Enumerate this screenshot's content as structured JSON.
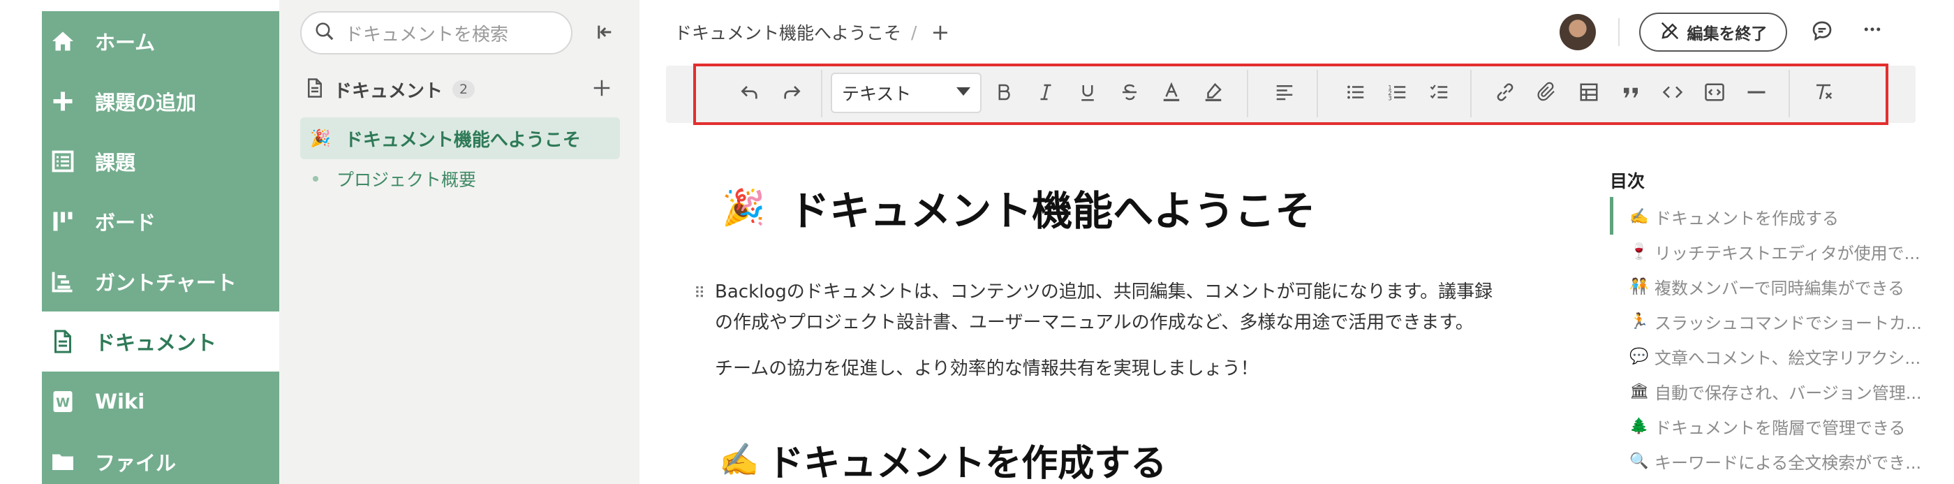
{
  "nav": {
    "items": [
      {
        "label": "ホーム",
        "icon": "home-icon",
        "active": false
      },
      {
        "label": "課題の追加",
        "icon": "plus-icon",
        "active": false
      },
      {
        "label": "課題",
        "icon": "list-icon",
        "active": false
      },
      {
        "label": "ボード",
        "icon": "board-icon",
        "active": false
      },
      {
        "label": "ガントチャート",
        "icon": "gantt-icon",
        "active": false
      },
      {
        "label": "ドキュメント",
        "icon": "document-icon",
        "active": true
      },
      {
        "label": "Wiki",
        "icon": "wiki-icon",
        "active": false
      },
      {
        "label": "ファイル",
        "icon": "folder-icon",
        "active": false
      }
    ],
    "colors": {
      "bg": "#73ad8e",
      "active_text": "#2e7a57"
    }
  },
  "tree": {
    "search_placeholder": "ドキュメントを検索",
    "header_label": "ドキュメント",
    "count": "2",
    "items": [
      {
        "emoji": "🎉",
        "label": "ドキュメント機能へようこそ",
        "active": true
      },
      {
        "emoji": "",
        "label": "プロジェクト概要",
        "active": false
      }
    ]
  },
  "header": {
    "breadcrumb": "ドキュメント機能へようこそ",
    "breadcrumb_sep": "/",
    "add": "+",
    "end_edit_label": "編集を終了"
  },
  "toolbar": {
    "text_style": "テキスト"
  },
  "document": {
    "title_emoji": "🎉",
    "title": "ドキュメント機能へようこそ",
    "drag_handle": "⠿",
    "paragraph1_line1": "Backlogのドキュメントは、コンテンツの追加、共同編集、コメントが可能になります。議事録",
    "paragraph1_line2": "の作成やプロジェクト設計書、ユーザーマニュアルの作成など、多様な用途で活用できます。",
    "paragraph2": "チームの協力を促進し、より効率的な情報共有を実現しましょう！",
    "h2_emoji": "✍️",
    "h2": "ドキュメントを作成する"
  },
  "toc": {
    "title": "目次",
    "items": [
      {
        "emoji": "✍️",
        "label": "ドキュメントを作成する"
      },
      {
        "emoji": "🍷",
        "label": "リッチテキストエディタが使用で..."
      },
      {
        "emoji": "🧑‍🤝‍🧑",
        "label": "複数メンバーで同時編集ができる"
      },
      {
        "emoji": "🏃",
        "label": "スラッシュコマンドでショートカ..."
      },
      {
        "emoji": "💬",
        "label": "文章へコメント、絵文字リアクシ..."
      },
      {
        "emoji": "🏛",
        "label": "自動で保存され、バージョン管理..."
      },
      {
        "emoji": "🌲",
        "label": "ドキュメントを階層で管理できる"
      },
      {
        "emoji": "🔍",
        "label": "キーワードによる全文検索ができ..."
      }
    ]
  }
}
